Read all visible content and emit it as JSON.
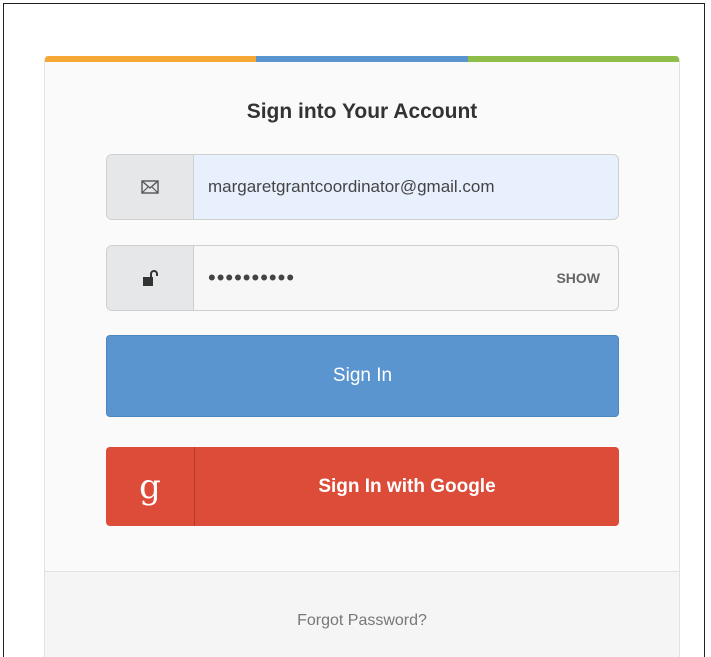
{
  "colors": {
    "bar_orange": "#f5a836",
    "bar_blue": "#5b95cf",
    "bar_green": "#8fbd4a",
    "signin_blue": "#5b95cf",
    "google_red": "#dd4b39"
  },
  "login": {
    "title": "Sign into Your Account",
    "email": {
      "icon": "envelope-icon",
      "value": "margaretgrantcoordinator@gmail.com"
    },
    "password": {
      "icon": "unlock-icon",
      "value": "••••••••••",
      "toggle_label": "SHOW"
    },
    "signin_label": "Sign In",
    "google": {
      "icon": "google-g-icon",
      "glyph": "g",
      "label": "Sign In with Google"
    },
    "forgot_label": "Forgot Password?"
  }
}
